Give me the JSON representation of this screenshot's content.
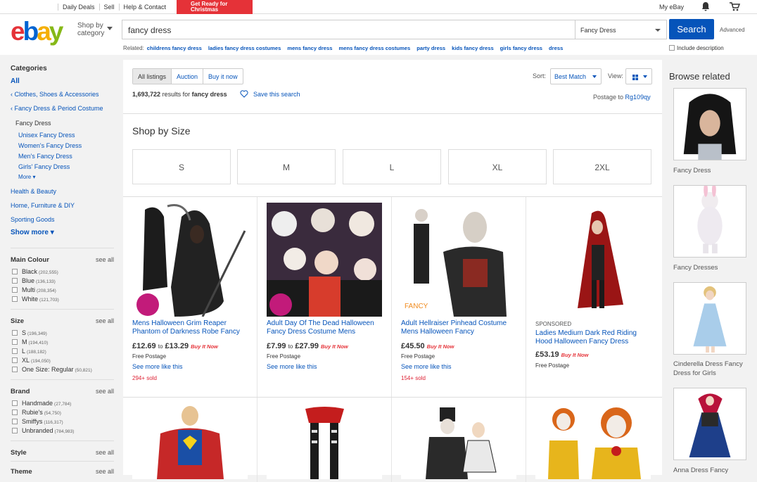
{
  "topbar": {
    "links": [
      "Daily Deals",
      "Sell",
      "Help & Contact"
    ],
    "promo": "Get Ready for Christmas",
    "my_ebay": "My eBay"
  },
  "header": {
    "shop_by_line1": "Shop by",
    "shop_by_line2": "category",
    "search_value": "fancy dress",
    "category_select": "Fancy Dress",
    "search_button": "Search",
    "advanced": "Advanced",
    "related_label": "Related:",
    "related": [
      "childrens fancy dress",
      "ladies fancy dress costumes",
      "mens fancy dress",
      "mens fancy dress costumes",
      "party dress",
      "kids fancy dress",
      "girls fancy dress",
      "dress"
    ],
    "include_description": "Include description"
  },
  "sidebar": {
    "categories_title": "Categories",
    "all": "All",
    "parent1": "‹ Clothes, Shoes & Accessories",
    "parent2": "‹ Fancy Dress & Period Costume",
    "current": "Fancy Dress",
    "sub": [
      "Unisex Fancy Dress",
      "Women's Fancy Dress",
      "Men's Fancy Dress",
      "Girls' Fancy Dress"
    ],
    "more": "More",
    "other": [
      "Health & Beauty",
      "Home, Furniture & DIY",
      "Sporting Goods"
    ],
    "show_more": "Show more",
    "see_all": "see all",
    "main_colour": {
      "title": "Main Colour",
      "items": [
        {
          "label": "Black",
          "count": "(202,555)"
        },
        {
          "label": "Blue",
          "count": "(136,133)"
        },
        {
          "label": "Multi",
          "count": "(208,354)"
        },
        {
          "label": "White",
          "count": "(121,703)"
        }
      ]
    },
    "size": {
      "title": "Size",
      "items": [
        {
          "label": "S",
          "count": "(196,349)"
        },
        {
          "label": "M",
          "count": "(194,410)"
        },
        {
          "label": "L",
          "count": "(188,182)"
        },
        {
          "label": "XL",
          "count": "(194,050)"
        },
        {
          "label": "One Size: Regular",
          "count": "(50,821)"
        }
      ]
    },
    "brand": {
      "title": "Brand",
      "items": [
        {
          "label": "Handmade",
          "count": "(27,784)"
        },
        {
          "label": "Rubie's",
          "count": "(54,750)"
        },
        {
          "label": "Smiffys",
          "count": "(116,317)"
        },
        {
          "label": "Unbranded",
          "count": "(784,983)"
        }
      ]
    },
    "style_title": "Style",
    "theme_title": "Theme"
  },
  "main": {
    "tabs": [
      "All listings",
      "Auction",
      "Buy it now"
    ],
    "results_count": "1,693,722",
    "results_text": "results for",
    "results_query": "fancy dress",
    "save_search": "Save this search",
    "sort_label": "Sort:",
    "sort_value": "Best Match",
    "view_label": "View:",
    "postage_label": "Postage to",
    "postage_code": "Rg109qy",
    "shop_by_size": "Shop by Size",
    "sizes": [
      "S",
      "M",
      "L",
      "XL",
      "2XL"
    ],
    "buy_it_now": "Buy It Now",
    "products": [
      {
        "title": "Mens Halloween Grim Reaper Phantom of Darkness Robe Fancy",
        "price_from": "£12.69",
        "to": "to",
        "price_to": "£13.29",
        "shipping": "Free Postage",
        "see_more": "See more like this",
        "sold": "294+ sold"
      },
      {
        "title": "Adult Day Of The Dead Halloween Fancy Dress Costume Mens",
        "price_from": "£7.99",
        "to": "to",
        "price_to": "£27.99",
        "shipping": "Free Postage",
        "see_more": "See more like this",
        "sold": ""
      },
      {
        "title": "Adult Hellraiser Pinhead Costume Mens Halloween Fancy",
        "price_from": "£45.50",
        "to": "",
        "price_to": "",
        "shipping": "Free Postage",
        "see_more": "See more like this",
        "sold": "154+ sold"
      },
      {
        "sponsored": "SPONSORED",
        "title": "Ladies Medium Dark Red Riding Hood Halloween Fancy Dress",
        "price_from": "£53.19",
        "to": "",
        "price_to": "",
        "shipping": "Free Postage",
        "see_more": "",
        "sold": ""
      }
    ]
  },
  "right": {
    "title": "Browse related",
    "items": [
      "Fancy Dress",
      "Fancy Dresses",
      "Cinderella Dress Fancy Dress for Girls",
      "Anna Dress Fancy"
    ]
  },
  "colors": {
    "accent": "#0654ba",
    "sold": "#dd1e31"
  }
}
